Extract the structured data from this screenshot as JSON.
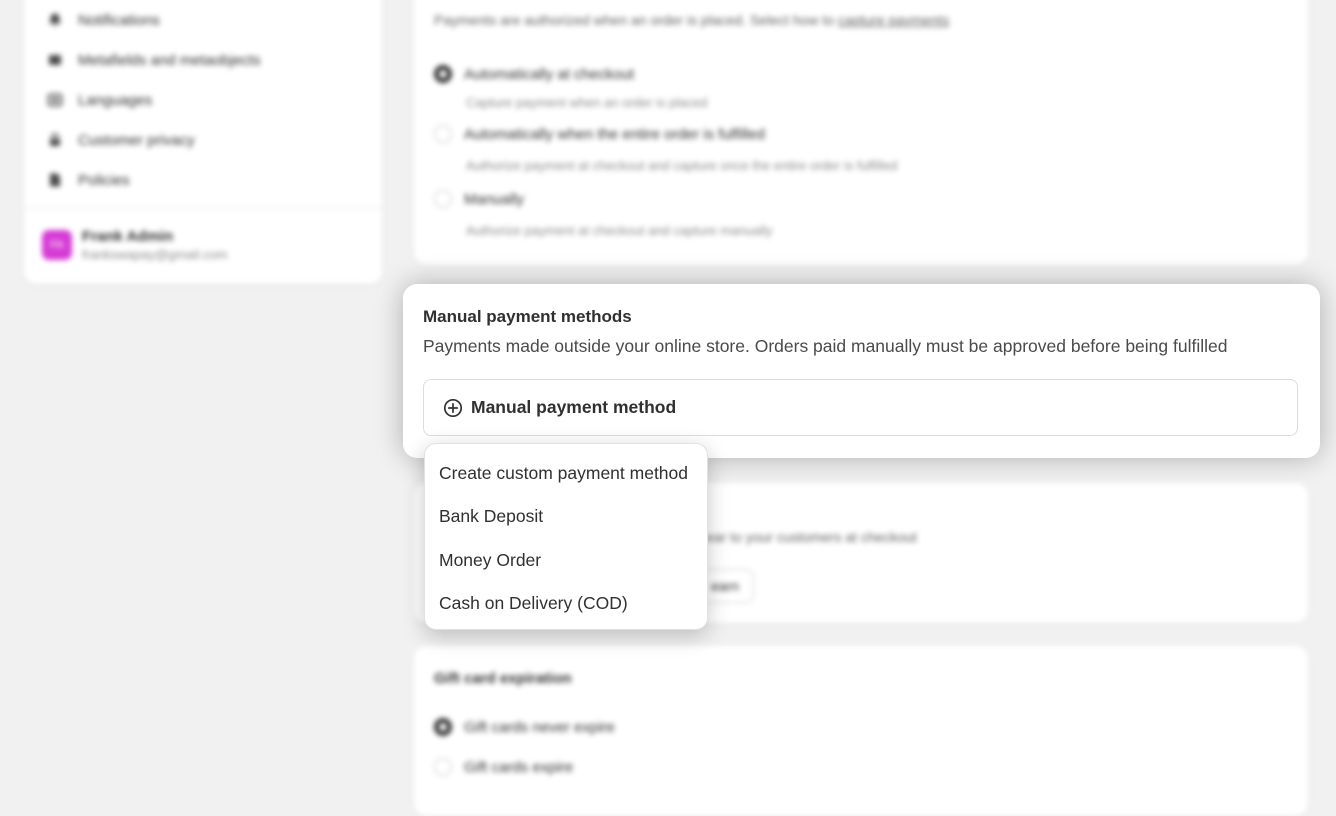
{
  "sidebar": {
    "items": [
      {
        "label": "Notifications",
        "icon": "bell-icon"
      },
      {
        "label": "Metafields and metaobjects",
        "icon": "metafields-icon"
      },
      {
        "label": "Languages",
        "icon": "languages-icon"
      },
      {
        "label": "Customer privacy",
        "icon": "lock-icon"
      },
      {
        "label": "Policies",
        "icon": "policies-icon"
      }
    ],
    "user": {
      "initials": "FA",
      "name": "Frank Admin",
      "email": "frankswapay@gmail.com"
    }
  },
  "capture_card": {
    "description_prefix": "Payments are authorized when an order is placed. Select how to ",
    "description_link": "capture payments",
    "options": [
      {
        "label": "Automatically at checkout",
        "help": "Capture payment when an order is placed",
        "selected": true
      },
      {
        "label": "Automatically when the entire order is fulfilled",
        "help": "Authorize payment at checkout and capture once the entire order is fulfilled",
        "selected": false
      },
      {
        "label": "Manually",
        "help": "Authorize payment at checkout and capture manually",
        "selected": false
      }
    ]
  },
  "manual_methods": {
    "title": "Manual payment methods",
    "description": "Payments made outside your online store. Orders paid manually must be approved before being fulfilled",
    "add_button_label": "Manual payment method",
    "add_icon": "plus-circle-icon"
  },
  "dropdown": {
    "items": [
      "Create custom payment method",
      "Bank Deposit",
      "Money Order",
      "Cash on Delivery (COD)"
    ]
  },
  "hidden_card": {
    "description_fragment": "ear to your customers at checkout",
    "button_fragment": "earn"
  },
  "gift_card": {
    "title": "Gift card expiration",
    "options": [
      {
        "label": "Gift cards never expire",
        "selected": true
      },
      {
        "label": "Gift cards expire",
        "selected": false
      }
    ]
  },
  "colors": {
    "page_bg": "#f1f1f1",
    "avatar": "#d63ad6",
    "text": "#303030"
  }
}
